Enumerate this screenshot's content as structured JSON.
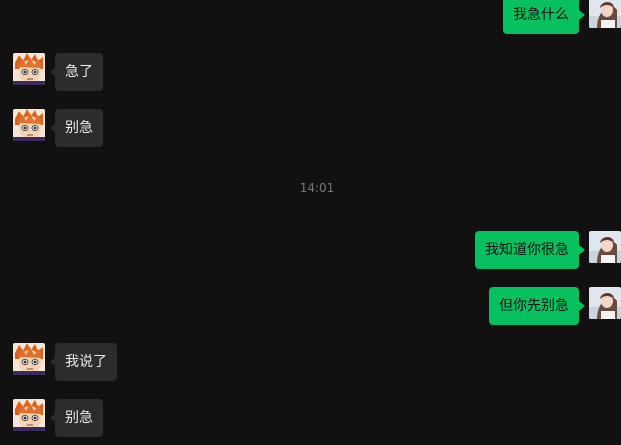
{
  "messages": [
    {
      "side": "out",
      "text": "我急什么"
    },
    {
      "side": "in",
      "text": "急了"
    },
    {
      "side": "in",
      "text": "别急"
    },
    {
      "side": "time",
      "text": "14:01"
    },
    {
      "side": "out",
      "text": "我知道你很急"
    },
    {
      "side": "out",
      "text": "但你先别急"
    },
    {
      "side": "in",
      "text": "我说了"
    },
    {
      "side": "in",
      "text": "别急"
    }
  ],
  "avatars": {
    "self": "user-avatar-girl",
    "other": "contact-avatar-anime-boy"
  },
  "colors": {
    "background": "#111111",
    "incoming_bubble": "#2c2c2c",
    "outgoing_bubble": "#07c160"
  }
}
